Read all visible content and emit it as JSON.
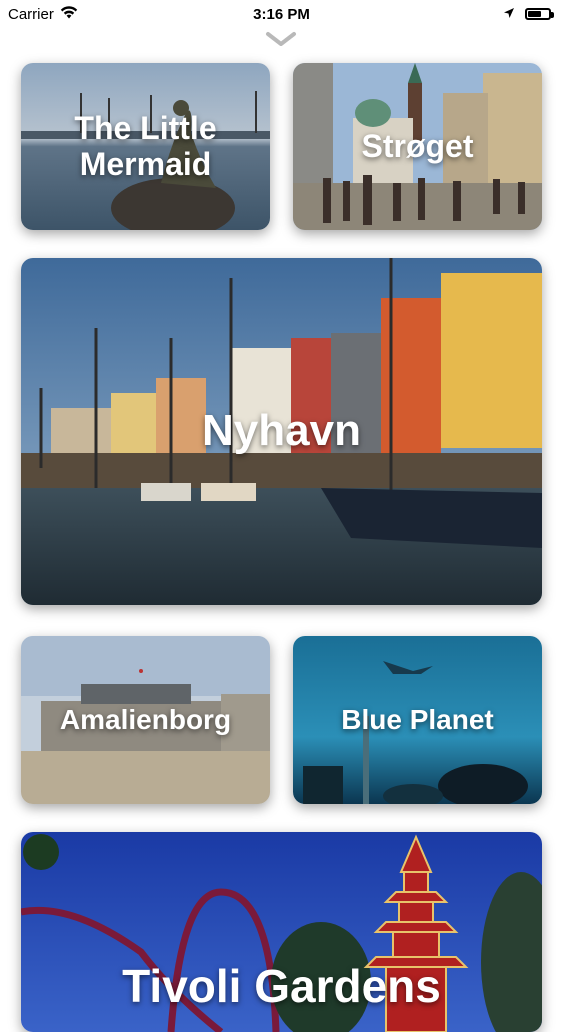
{
  "status_bar": {
    "carrier": "Carrier",
    "time": "3:16 PM"
  },
  "cards": {
    "little_mermaid": "The Little Mermaid",
    "stroget": "Strøget",
    "nyhavn": "Nyhavn",
    "amalienborg": "Amalienborg",
    "blue_planet": "Blue Planet",
    "tivoli": "Tivoli Gardens"
  },
  "icons": {
    "pull": "chevron-down-icon",
    "wifi": "wifi-icon",
    "location": "location-arrow-icon",
    "battery": "battery-icon"
  },
  "colors": {
    "accent": "#ffffff",
    "chevron": "#b9b9b9"
  }
}
